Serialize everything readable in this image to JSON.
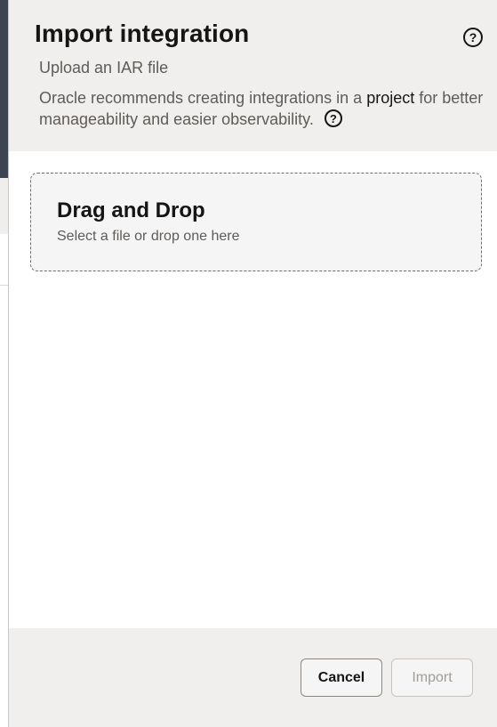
{
  "dialog": {
    "title": "Import integration",
    "subtitle": "Upload an IAR file",
    "description_before": "Oracle recommends creating integrations in a ",
    "description_link": "project",
    "description_after": " for better manageability and easier observability.",
    "help_glyph": "?"
  },
  "dropzone": {
    "title": "Drag and Drop",
    "subtitle": "Select a file or drop one here"
  },
  "footer": {
    "cancel_label": "Cancel",
    "import_label": "Import",
    "import_disabled": true
  },
  "icons": {
    "help": "help-circle-icon"
  },
  "colors": {
    "header_bg": "#f1efed",
    "text_primary": "#161513",
    "text_secondary": "#5e5b58",
    "disabled_text": "#a09d99"
  }
}
